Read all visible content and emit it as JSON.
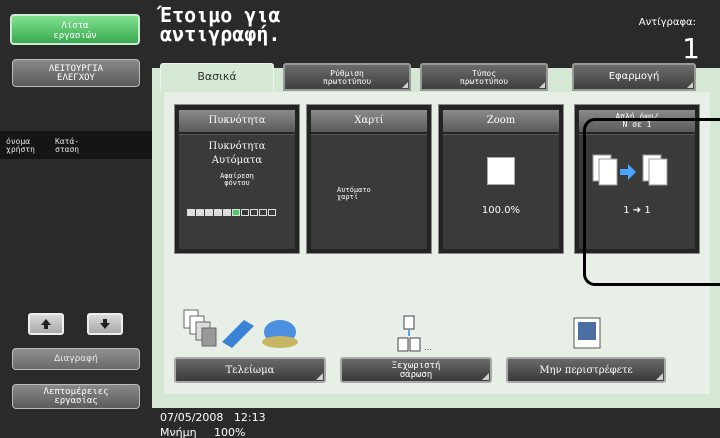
{
  "sidebar": {
    "job_list_label": "Λίστα\nεργασιών",
    "function_label": "ΛΕΙΤΟΥΡΓΙΑ\nΕΛΕΓΧΟΥ",
    "user_name_label": "όνομα\nχρήστη",
    "status_label": "Κατά-\nσταση",
    "delete_label": "Διαγραφή",
    "job_details_label": "Λεπτομέρειες\nεργασίας"
  },
  "header": {
    "status_title": "Έτοιμο για\nαντιγραφή.",
    "copies_label": "Αντίγραφα:",
    "copies_count": "1"
  },
  "tabs": [
    {
      "label": "Βασικά"
    },
    {
      "label": "Ρύθμιση\nπρωτοτύπου"
    },
    {
      "label": "Τύπος\nπρωτοτύπου"
    },
    {
      "label": "Εφαρμογή"
    }
  ],
  "cards": {
    "density": {
      "title": "Πυκνότητα",
      "line1": "Πυκνότητα",
      "line2": "Αυτόματα",
      "line3": "Αφαίρεση\nφόντου"
    },
    "paper": {
      "title": "Χαρτί",
      "value": "Αυτόματο\nχαρτί"
    },
    "zoom": {
      "title": "Zoom",
      "value": "100.0%"
    },
    "duplex": {
      "title": "Απλή όψη/\nΝ σε 1",
      "value": "1 ➜ 1"
    }
  },
  "footer_buttons": {
    "finishing": "Τελείωμα",
    "separate_scan": "Ξεχωριστή\nσάρωση",
    "no_rotate": "Μην περιστρέφετε"
  },
  "bottom_bar": {
    "datetime": "07/05/2008   12:13",
    "memory": "Μνήμη     100%"
  },
  "colors": {
    "accent_green": "#4fc96a",
    "panel_bg": "#d4e8d3",
    "dark": "#2a2a2a"
  }
}
